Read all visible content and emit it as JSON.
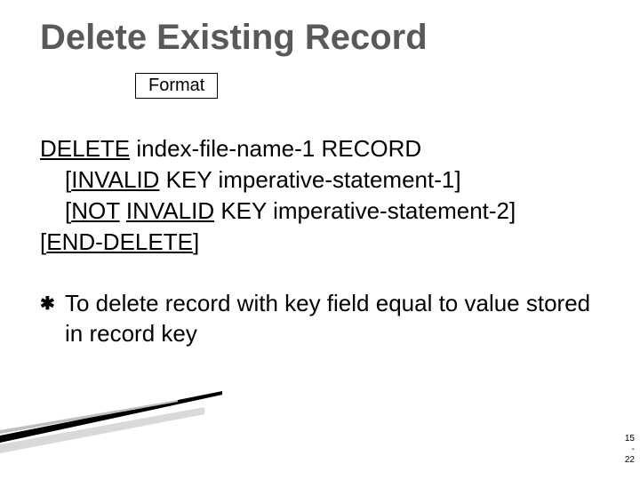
{
  "title": "Delete Existing Record",
  "format_label": "Format",
  "syntax": {
    "kw_delete": "DELETE",
    "after_delete": " index-file-name-1 RECORD",
    "line2_open": "[",
    "kw_invalid": "INVALID",
    "line2_rest": " KEY imperative-statement-1]",
    "line3_open": "[",
    "kw_not": "NOT",
    "space": " ",
    "kw_invalid2": "INVALID",
    "line3_rest": " KEY imperative-statement-2]",
    "line4_open": "[",
    "kw_end_delete": "END-DELETE",
    "line4_close": "]"
  },
  "bullet": {
    "glyph": "✱",
    "text": "To delete record with key field equal to value stored in record key"
  },
  "pagenum": {
    "top": "15",
    "mid": "-",
    "bot": "22"
  }
}
